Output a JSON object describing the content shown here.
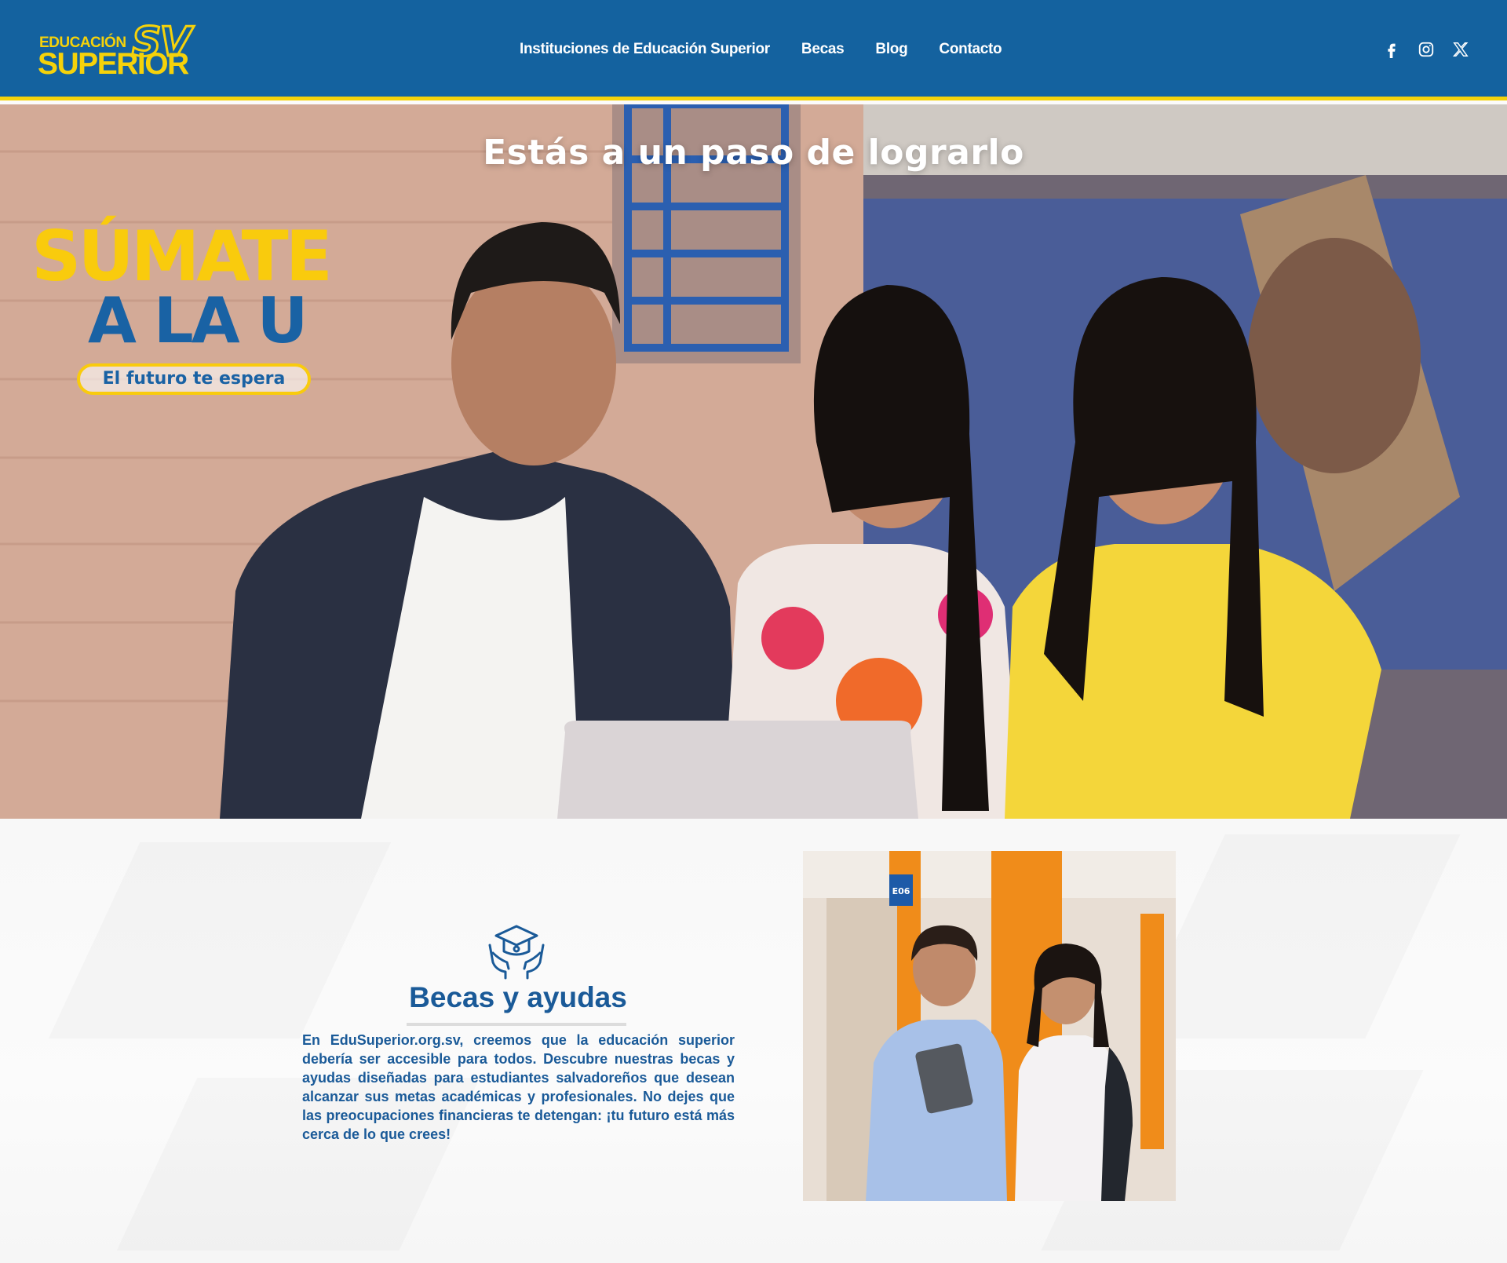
{
  "header": {
    "logo": {
      "line1": "EDUCACIÓN",
      "line2": "SUPERIOR",
      "badge": "SV"
    },
    "nav": [
      {
        "label": "Instituciones de Educación Superior"
      },
      {
        "label": "Becas"
      },
      {
        "label": "Blog"
      },
      {
        "label": "Contacto"
      }
    ],
    "social": [
      "facebook-icon",
      "instagram-icon",
      "x-icon"
    ]
  },
  "hero": {
    "title": "Estás a un paso de lograrlo",
    "promo": {
      "line1": "SÚMATE",
      "line2": "A LA U",
      "tagline": "El futuro te espera"
    }
  },
  "becas": {
    "icon": "graduation-cap-hands-icon",
    "title": "Becas y ayudas",
    "text": "En EduSuperior.org.sv, creemos que la educación superior debería ser accesible para todos. Descubre nuestras becas y ayudas diseñadas para estudiantes salvadoreños que desean alcanzar sus metas académicas y profesionales. No dejes que las preocupaciones financieras te detengan: ¡tu futuro está más cerca de lo que crees!",
    "photo_sign": "E06"
  },
  "colors": {
    "header_bg": "#14629f",
    "accent_yellow": "#f5d20a",
    "brand_blue": "#1a5a98"
  }
}
